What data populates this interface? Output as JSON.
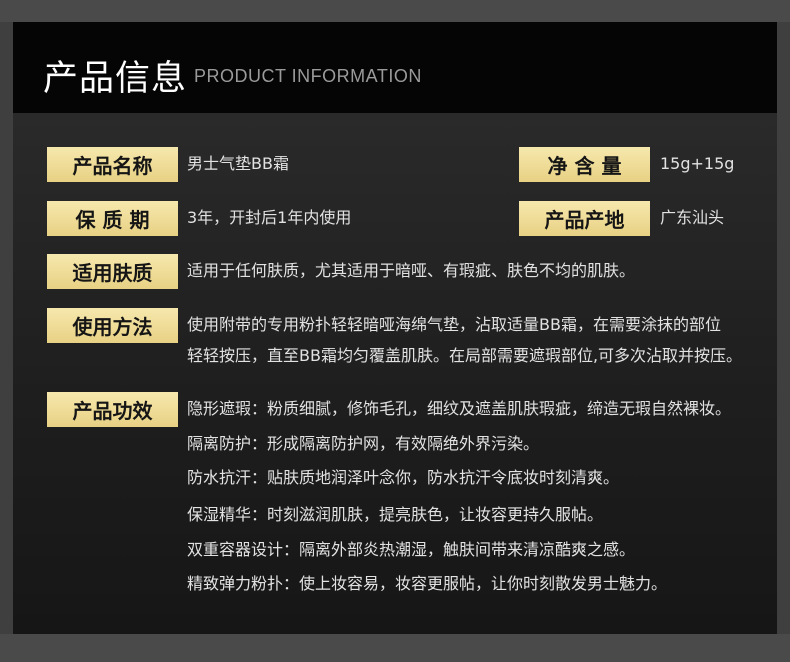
{
  "header": {
    "title": "产品信息",
    "subtitle": "PRODUCT INFORMATION"
  },
  "rows": {
    "name": {
      "label": "产品名称",
      "value": "男士气垫BB霜"
    },
    "net": {
      "label": "净 含 量",
      "value": "15g+15g"
    },
    "shelf": {
      "label": "保 质 期",
      "value": "3年，开封后1年内使用"
    },
    "origin": {
      "label": "产品产地",
      "value": "广东汕头"
    },
    "skin": {
      "label": "适用肤质",
      "value": "适用于任何肤质，尤其适用于暗哑、有瑕疵、肤色不均的肌肤。"
    },
    "usage": {
      "label": "使用方法",
      "line1": "使用附带的专用粉扑轻轻暗哑海绵气垫，沾取适量BB霜，在需要涂抹的部位",
      "line2": "轻轻按压，直至BB霜均匀覆盖肌肤。在局部需要遮瑕部位,可多次沾取并按压。"
    },
    "effects": {
      "label": "产品功效",
      "items": [
        "隐形遮瑕：粉质细腻，修饰毛孔，细纹及遮盖肌肤瑕疵，缔造无瑕自然裸妆。",
        "隔离防护：形成隔离防护网，有效隔绝外界污染。",
        "防水抗汗：贴肤质地润泽叶念你，防水抗汗令底妆时刻清爽。",
        "保湿精华：时刻滋润肌肤，提亮肤色，让妆容更持久服帖。",
        "双重容器设计：隔离外部炎热潮湿，触肤间带来清凉酷爽之感。",
        "精致弹力粉扑：使上妆容易，妆容更服帖，让你时刻散发男士魅力。"
      ]
    }
  },
  "colors": {
    "label_bg": "#eedc99",
    "label_text": "#151515",
    "value_text": "#e2e2e2",
    "header_bg": "#050505"
  }
}
